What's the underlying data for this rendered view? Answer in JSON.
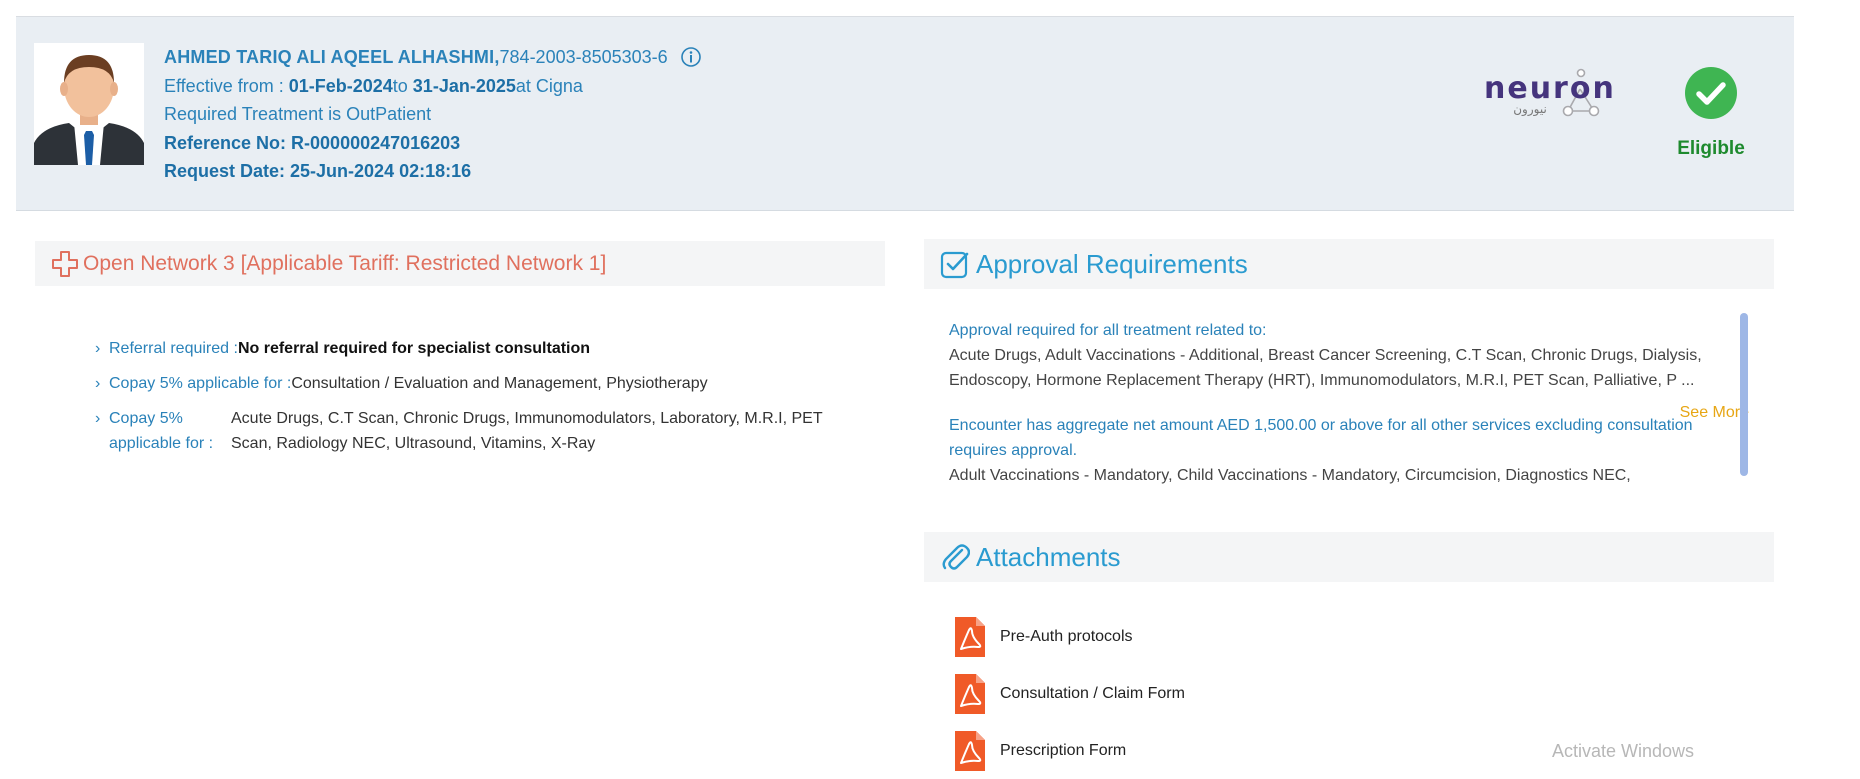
{
  "member": {
    "name": "AHMED TARIQ ALI AQEEL ALHASHMI,",
    "id_number": "784-2003-8505303-6",
    "effective_prefix": "Effective from : ",
    "effective_from": "01-Feb-2024",
    "effective_to_word": "to ",
    "effective_to": "31-Jan-2025",
    "insurer_text": "at Cigna",
    "treatment": "Required Treatment is OutPatient",
    "reference": "Reference No: R-000000247016203",
    "request_date": "Request Date: 25-Jun-2024 02:18:16"
  },
  "icons": {
    "avatar": "user-avatar",
    "info": "info-icon",
    "eligible": "check-circle-icon",
    "network": "cross-outline-icon",
    "approval": "checkbox-icon",
    "attachments": "paperclip-icon",
    "pdf": "pdf-file-icon",
    "chevron": "chevron-right-icon"
  },
  "logo": {
    "brand": "neuron",
    "brand_arabic": "نيورون"
  },
  "status": {
    "label": "Eligible",
    "color": "#1e8a2e"
  },
  "network": {
    "title": "Open Network 3 [Applicable Tariff: Restricted Network 1]"
  },
  "benefits": [
    {
      "label": "Referral required :",
      "value": "No referral required for specialist consultation",
      "bold": true
    },
    {
      "label": "Copay 5% applicable for :",
      "value": "Consultation / Evaluation and Management, Physiotherapy",
      "bold": false
    },
    {
      "label": "Copay 5% applicable for :",
      "value": "Acute Drugs, C.T Scan, Chronic Drugs, Immunomodulators, Laboratory, M.R.I, PET Scan, Radiology NEC, Ultrasound, Vitamins, X-Ray",
      "bold": false
    }
  ],
  "approval": {
    "title": "Approval Requirements",
    "heading1": "Approval required for all treatment related to:",
    "text1": "Acute Drugs, Adult Vaccinations - Additional, Breast Cancer Screening, C.T Scan, Chronic Drugs, Dialysis, Endoscopy, Hormone Replacement Therapy (HRT), Immunomodulators, M.R.I, PET Scan, Palliative, P ...",
    "see_more": "See More",
    "heading2": "Encounter has aggregate net amount AED 1,500.00 or above for all other services excluding consultation requires approval.",
    "text2": "Adult Vaccinations - Mandatory, Child Vaccinations - Mandatory, Circumcision, Diagnostics NEC,"
  },
  "attachments": {
    "title": "Attachments",
    "items": [
      "Pre-Auth protocols",
      "Consultation / Claim Form",
      "Prescription Form"
    ]
  },
  "watermark": "Activate Windows",
  "colors": {
    "accent_blue": "#2a82b9",
    "title_blue": "#2a9bd0",
    "network_red": "#e0705e",
    "see_more": "#e7a614",
    "pdf_red": "#f05a28"
  }
}
